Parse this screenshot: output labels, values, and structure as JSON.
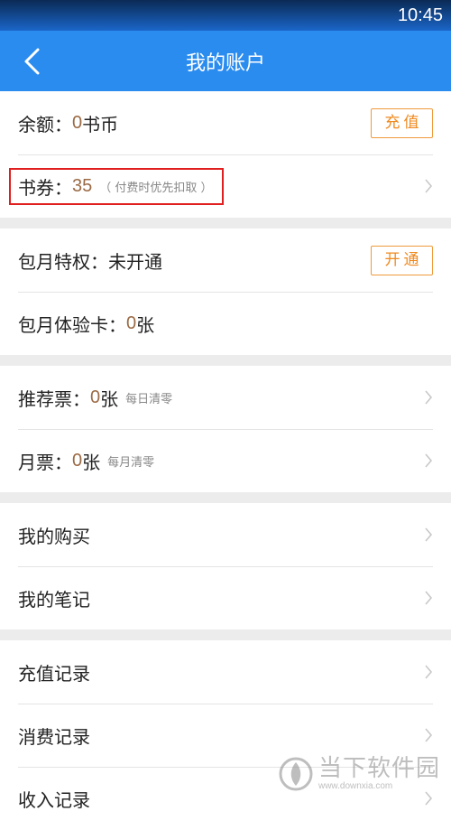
{
  "status_bar": {
    "time": "10:45"
  },
  "header": {
    "title": "我的账户"
  },
  "balance": {
    "label": "余额：",
    "value": "0",
    "unit": "书币",
    "button": "充值"
  },
  "voucher": {
    "label": "书券：",
    "value": "35",
    "note": "（ 付费时优先扣取 ）"
  },
  "monthly": {
    "label": "包月特权：未开通",
    "button": "开通"
  },
  "trial_card": {
    "label": "包月体验卡：",
    "value": "0",
    "unit": "张"
  },
  "recommend_ticket": {
    "label": "推荐票：",
    "value": "0",
    "unit": "张",
    "note": "每日清零"
  },
  "monthly_ticket": {
    "label": "月票：",
    "value": "0",
    "unit": "张",
    "note": "每月清零"
  },
  "purchases": {
    "label": "我的购买"
  },
  "notes": {
    "label": "我的笔记"
  },
  "recharge_records": {
    "label": "充值记录"
  },
  "spend_records": {
    "label": "消费记录"
  },
  "income_records": {
    "label": "收入记录"
  },
  "watermark": {
    "name": "当下软件园",
    "url": "www.downxia.com"
  },
  "colors": {
    "header": "#2b8cf0",
    "value": "#9b6a44",
    "button_border": "#ef9a3c",
    "highlight": "#e02020"
  }
}
